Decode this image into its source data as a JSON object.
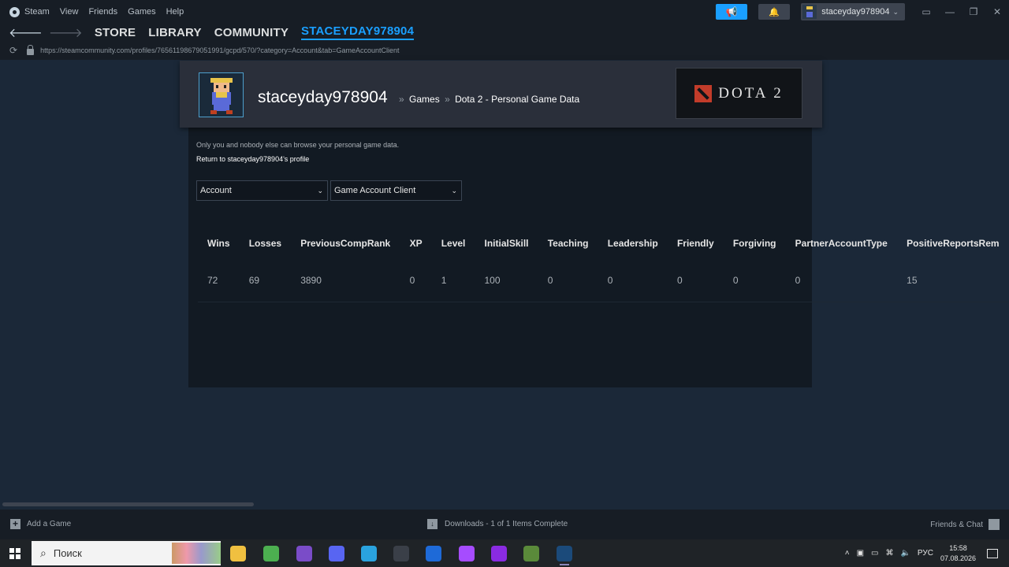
{
  "titlebar": {
    "menu": [
      "Steam",
      "View",
      "Friends",
      "Games",
      "Help"
    ],
    "username": "staceyday978904",
    "icons": {
      "announce": "megaphone-icon",
      "notifications": "bell-icon"
    },
    "window_controls": [
      "monitor-icon",
      "minimize-icon",
      "restore-icon",
      "close-icon"
    ]
  },
  "nav": {
    "links": [
      "STORE",
      "LIBRARY",
      "COMMUNITY",
      "STACEYDAY978904"
    ],
    "active_index": 3
  },
  "url": "https://steamcommunity.com/profiles/76561198679051991/gcpd/570/?category=Account&tab=GameAccountClient",
  "profile": {
    "name": "staceyday978904",
    "breadcrumb": [
      "Games",
      "Dota 2 - Personal Game Data"
    ],
    "game_logo": "DOTA 2"
  },
  "page": {
    "notice": "Only you and nobody else can browse your personal game data.",
    "return_link": "Return to staceyday978904's profile",
    "category_select": "Account",
    "tab_select": "Game Account Client"
  },
  "table": {
    "headers": [
      "Wins",
      "Losses",
      "PreviousCompRank",
      "XP",
      "Level",
      "InitialSkill",
      "Teaching",
      "Leadership",
      "Friendly",
      "Forgiving",
      "PartnerAccountType",
      "PositiveReportsRem"
    ],
    "rows": [
      [
        "72",
        "69",
        "3890",
        "0",
        "1",
        "100",
        "0",
        "0",
        "0",
        "0",
        "0",
        "15"
      ]
    ]
  },
  "bottombar": {
    "add_game": "Add a Game",
    "downloads": "Downloads - 1 of 1 Items Complete",
    "friends": "Friends & Chat"
  },
  "taskbar": {
    "search_placeholder": "Поиск",
    "language": "РУС",
    "time": "15:58",
    "date": "07.08.2026",
    "apps": [
      {
        "name": "file-explorer-icon",
        "color": "#f0c040"
      },
      {
        "name": "chrome-icon",
        "color": "#4caf50"
      },
      {
        "name": "app-icon",
        "color": "#7a4cc8"
      },
      {
        "name": "discord-icon",
        "color": "#5865f2"
      },
      {
        "name": "telegram-icon",
        "color": "#2aa3df"
      },
      {
        "name": "wordpad-icon",
        "color": "#3a3f48"
      },
      {
        "name": "word-icon",
        "color": "#1e6ad8"
      },
      {
        "name": "purple-app-icon",
        "color": "#a64cff"
      },
      {
        "name": "vk-music-icon",
        "color": "#8a2be2"
      },
      {
        "name": "minecraft-icon",
        "color": "#5a8a3a"
      },
      {
        "name": "steam-icon",
        "color": "#1b4a7a"
      }
    ]
  }
}
